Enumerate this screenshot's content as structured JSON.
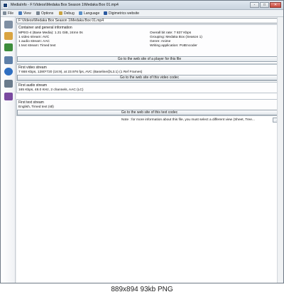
{
  "window": {
    "title": "MediaInfo - F:\\Videos\\Medaka Box Season 1\\Medaka Box 01.mp4",
    "min_label": "-",
    "max_label": "□",
    "close_label": "✕"
  },
  "menu": {
    "items": [
      {
        "label": "File",
        "icon": "file-icon",
        "color": "#7d8b99"
      },
      {
        "label": "View",
        "icon": "view-icon",
        "color": "#4a7bb8"
      },
      {
        "label": "Options",
        "icon": "options-icon",
        "color": "#7a8794"
      },
      {
        "label": "Debug",
        "icon": "debug-icon",
        "color": "#c9a341"
      },
      {
        "label": "Language",
        "icon": "language-icon",
        "color": "#5a8fc6"
      },
      {
        "label": "Digimetrics website",
        "icon": "website-icon",
        "color": "#2c5aa0"
      }
    ]
  },
  "sidebar": {
    "icons": [
      {
        "name": "open-file-icon",
        "color": "#7e8fa3"
      },
      {
        "name": "open-folder-icon",
        "color": "#d9a441"
      },
      {
        "name": "export-icon",
        "color": "#3c8d3c"
      },
      {
        "name": "sheet-icon",
        "color": "#5d7fa8"
      },
      {
        "name": "info-icon",
        "color": "#2f6fc1"
      },
      {
        "name": "preferences-icon",
        "color": "#6a7b8c"
      },
      {
        "name": "about-icon",
        "color": "#7a4aa0"
      }
    ]
  },
  "file": {
    "selected": "F:\\Videos\\Medaka Box Season 1\\Medaka Box 01.mp4"
  },
  "general": {
    "title": "Container and general information",
    "left": [
      "MPEG-4 (Base Media): 1.31 GiB, 24mn 0s",
      "1 video stream: AVC",
      "1 audio stream: AAC",
      "1 text stream: Timed text"
    ],
    "right": [
      "Overall bit rate: 7 837 Kbps",
      "Grouping: Medaka Box (Season 1)",
      "Genre: Anime",
      "Writing application: PotEncoder"
    ],
    "button": "Go to the web site of a player for this file"
  },
  "video": {
    "title": "First video stream",
    "line": "7 668 Kbps, 1280*720 (16:9), at 23.976 fps, AVC (Baseline@L3.1) (1 Ref Frames)",
    "button": "Go to the web site of this video codec"
  },
  "audio": {
    "title": "First audio stream",
    "line": "165 Kbps, 48.0 KHz, 2 channels, AAC (LC)"
  },
  "text": {
    "title": "First text stream",
    "line": "English, Timed text (stl)",
    "button": "Go to the web site of this text codec"
  },
  "note": "Note : for more information about this file, you must select a different view (Sheet, Tree...",
  "more_label": "→",
  "footer": "889x894  93kb  PNG"
}
